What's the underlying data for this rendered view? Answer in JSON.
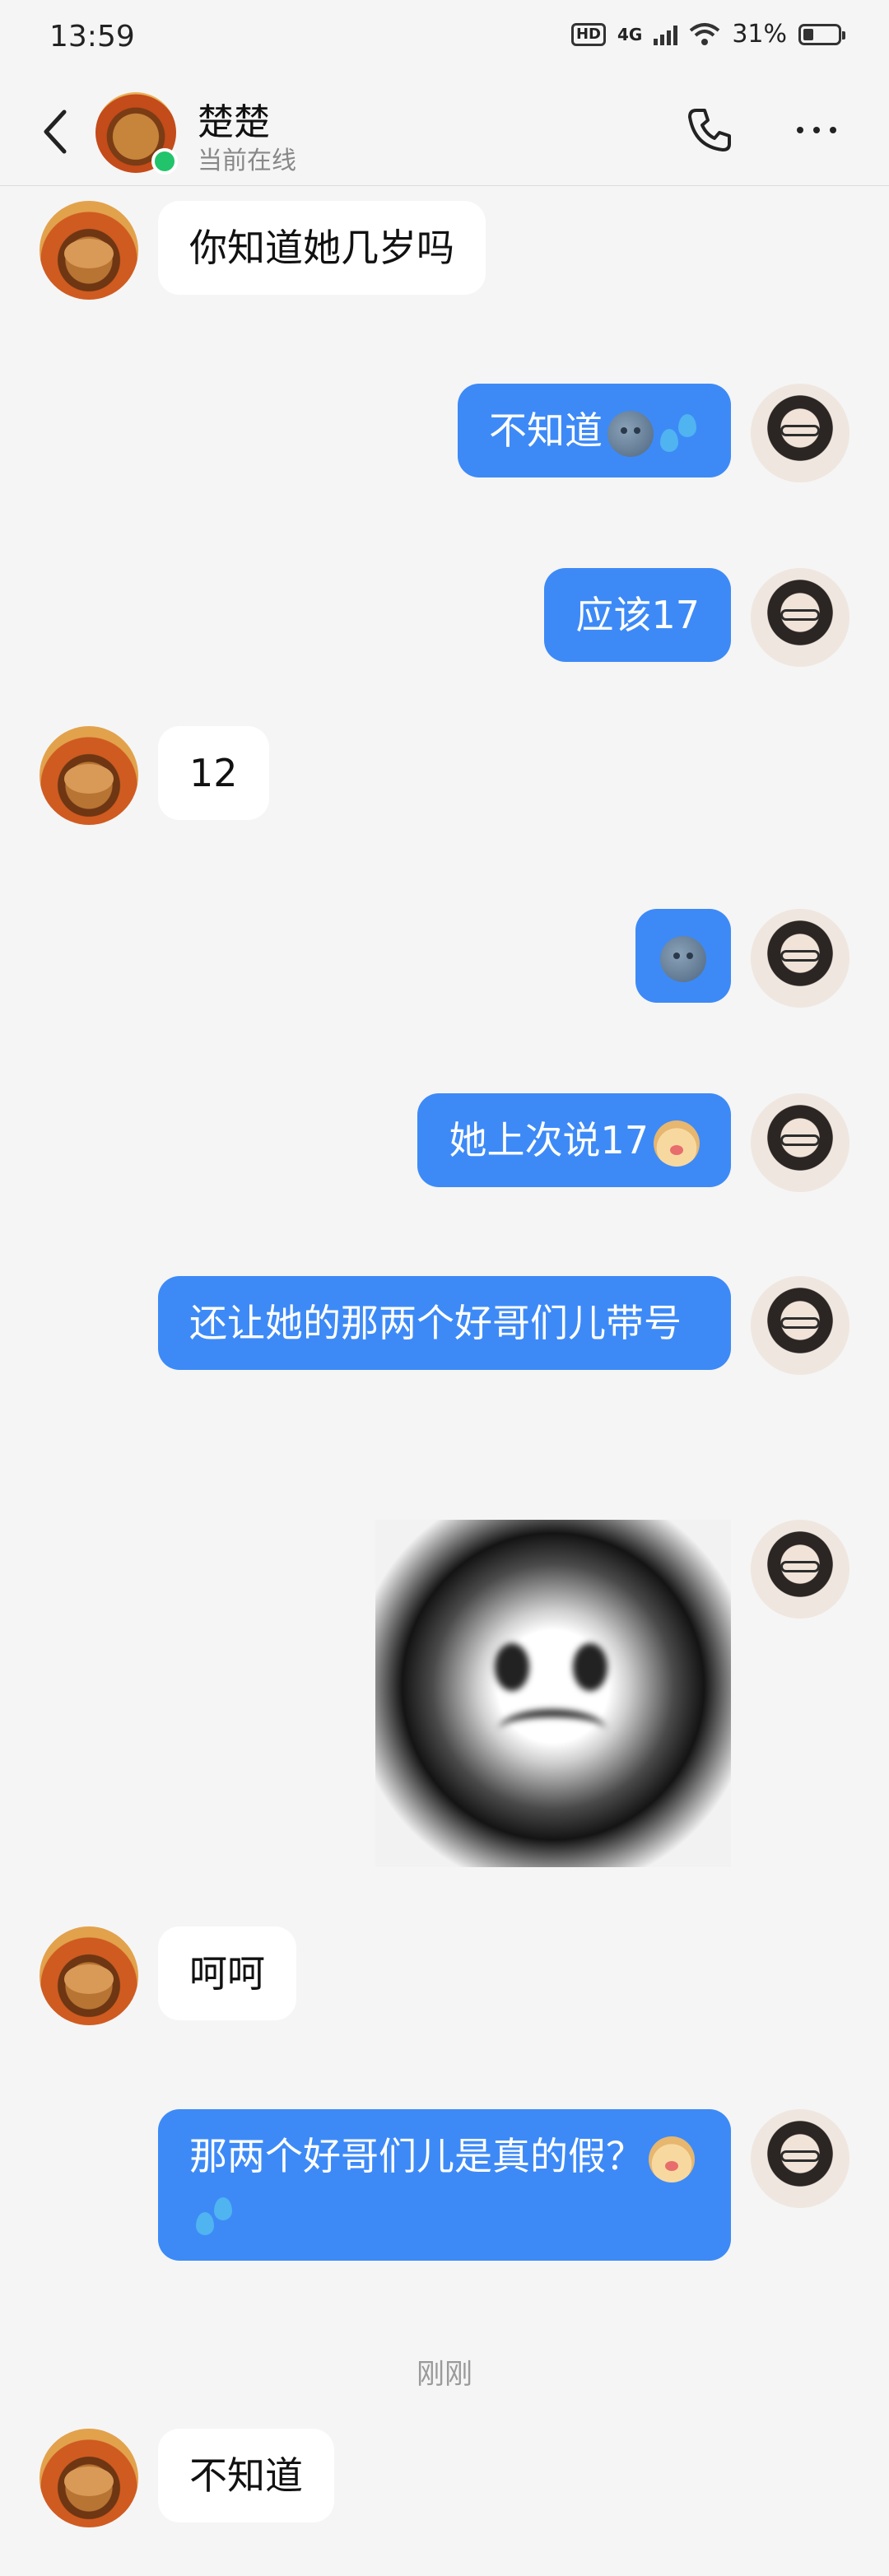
{
  "status_bar": {
    "time": "13:59",
    "hd": "HD",
    "network": "4G",
    "battery_text": "31%",
    "battery_level": 0.31
  },
  "header": {
    "contact_name": "楚楚",
    "contact_status": "当前在线"
  },
  "messages": [
    {
      "text": "你知道她几岁吗"
    },
    {
      "text": "不知道"
    },
    {
      "text": "应该17"
    },
    {
      "text": "12"
    },
    {
      "text": "她上次说17"
    },
    {
      "text": "还让她的那两个好哥们儿带号"
    },
    {
      "text": "呵呵"
    },
    {
      "text": "那两个好哥们儿是真的假？"
    },
    {
      "text": "不知道"
    }
  ],
  "timestamp_divider": "刚刚",
  "colors": {
    "accent": "#3d8af7",
    "online": "#21c46a",
    "background": "#f5f5f5"
  },
  "icons": [
    "back-arrow-icon",
    "phone-icon",
    "more-icon",
    "moon-emoji-icon",
    "sweat-drops-emoji-icon",
    "pig-emoji-icon"
  ]
}
